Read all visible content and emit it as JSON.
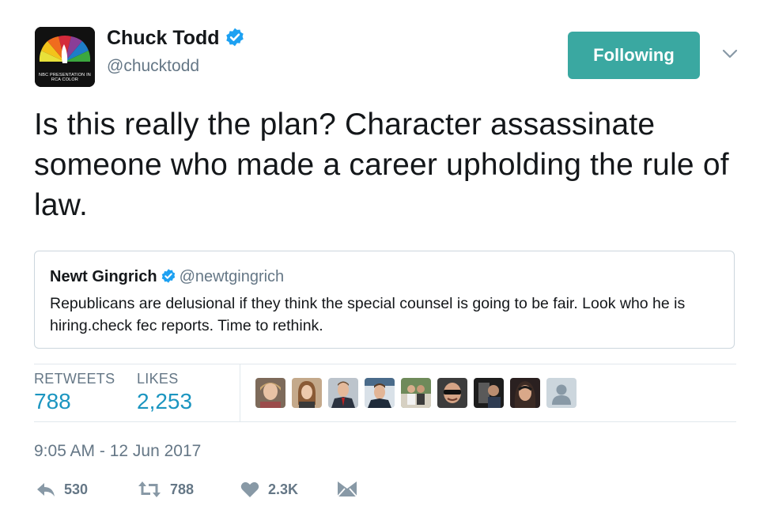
{
  "author": {
    "name": "Chuck Todd",
    "handle": "@chucktodd",
    "avatar_caption": "NBC PRESENTATION IN RCA COLOR",
    "verified": true
  },
  "follow_button": {
    "label": "Following",
    "color": "#3aa8a1"
  },
  "tweet": {
    "text": "Is this really the plan? Character assassinate someone who made a career upholding the rule of law."
  },
  "quoted_tweet": {
    "name": "Newt Gingrich",
    "handle": "@newtgingrich",
    "verified": true,
    "text": "Republicans are delusional if they think the special counsel is going to be fair. Look who he is hiring.check fec reports. Time to rethink."
  },
  "stats": {
    "retweets_label": "RETWEETS",
    "retweets_value": "788",
    "likes_label": "LIKES",
    "likes_value": "2,253"
  },
  "likers": [
    {
      "icon": "liker-avatar-1"
    },
    {
      "icon": "liker-avatar-2"
    },
    {
      "icon": "liker-avatar-3"
    },
    {
      "icon": "liker-avatar-4"
    },
    {
      "icon": "liker-avatar-5"
    },
    {
      "icon": "liker-avatar-6"
    },
    {
      "icon": "liker-avatar-7"
    },
    {
      "icon": "liker-avatar-8"
    },
    {
      "icon": "default-avatar-icon"
    }
  ],
  "timestamp": "9:05 AM - 12 Jun 2017",
  "actions": {
    "reply_count": "530",
    "retweet_count": "788",
    "like_count": "2.3K"
  },
  "colors": {
    "accent": "#1b95c0",
    "verified": "#1da1f2",
    "muted": "#657786",
    "border": "#e1e8ed"
  }
}
